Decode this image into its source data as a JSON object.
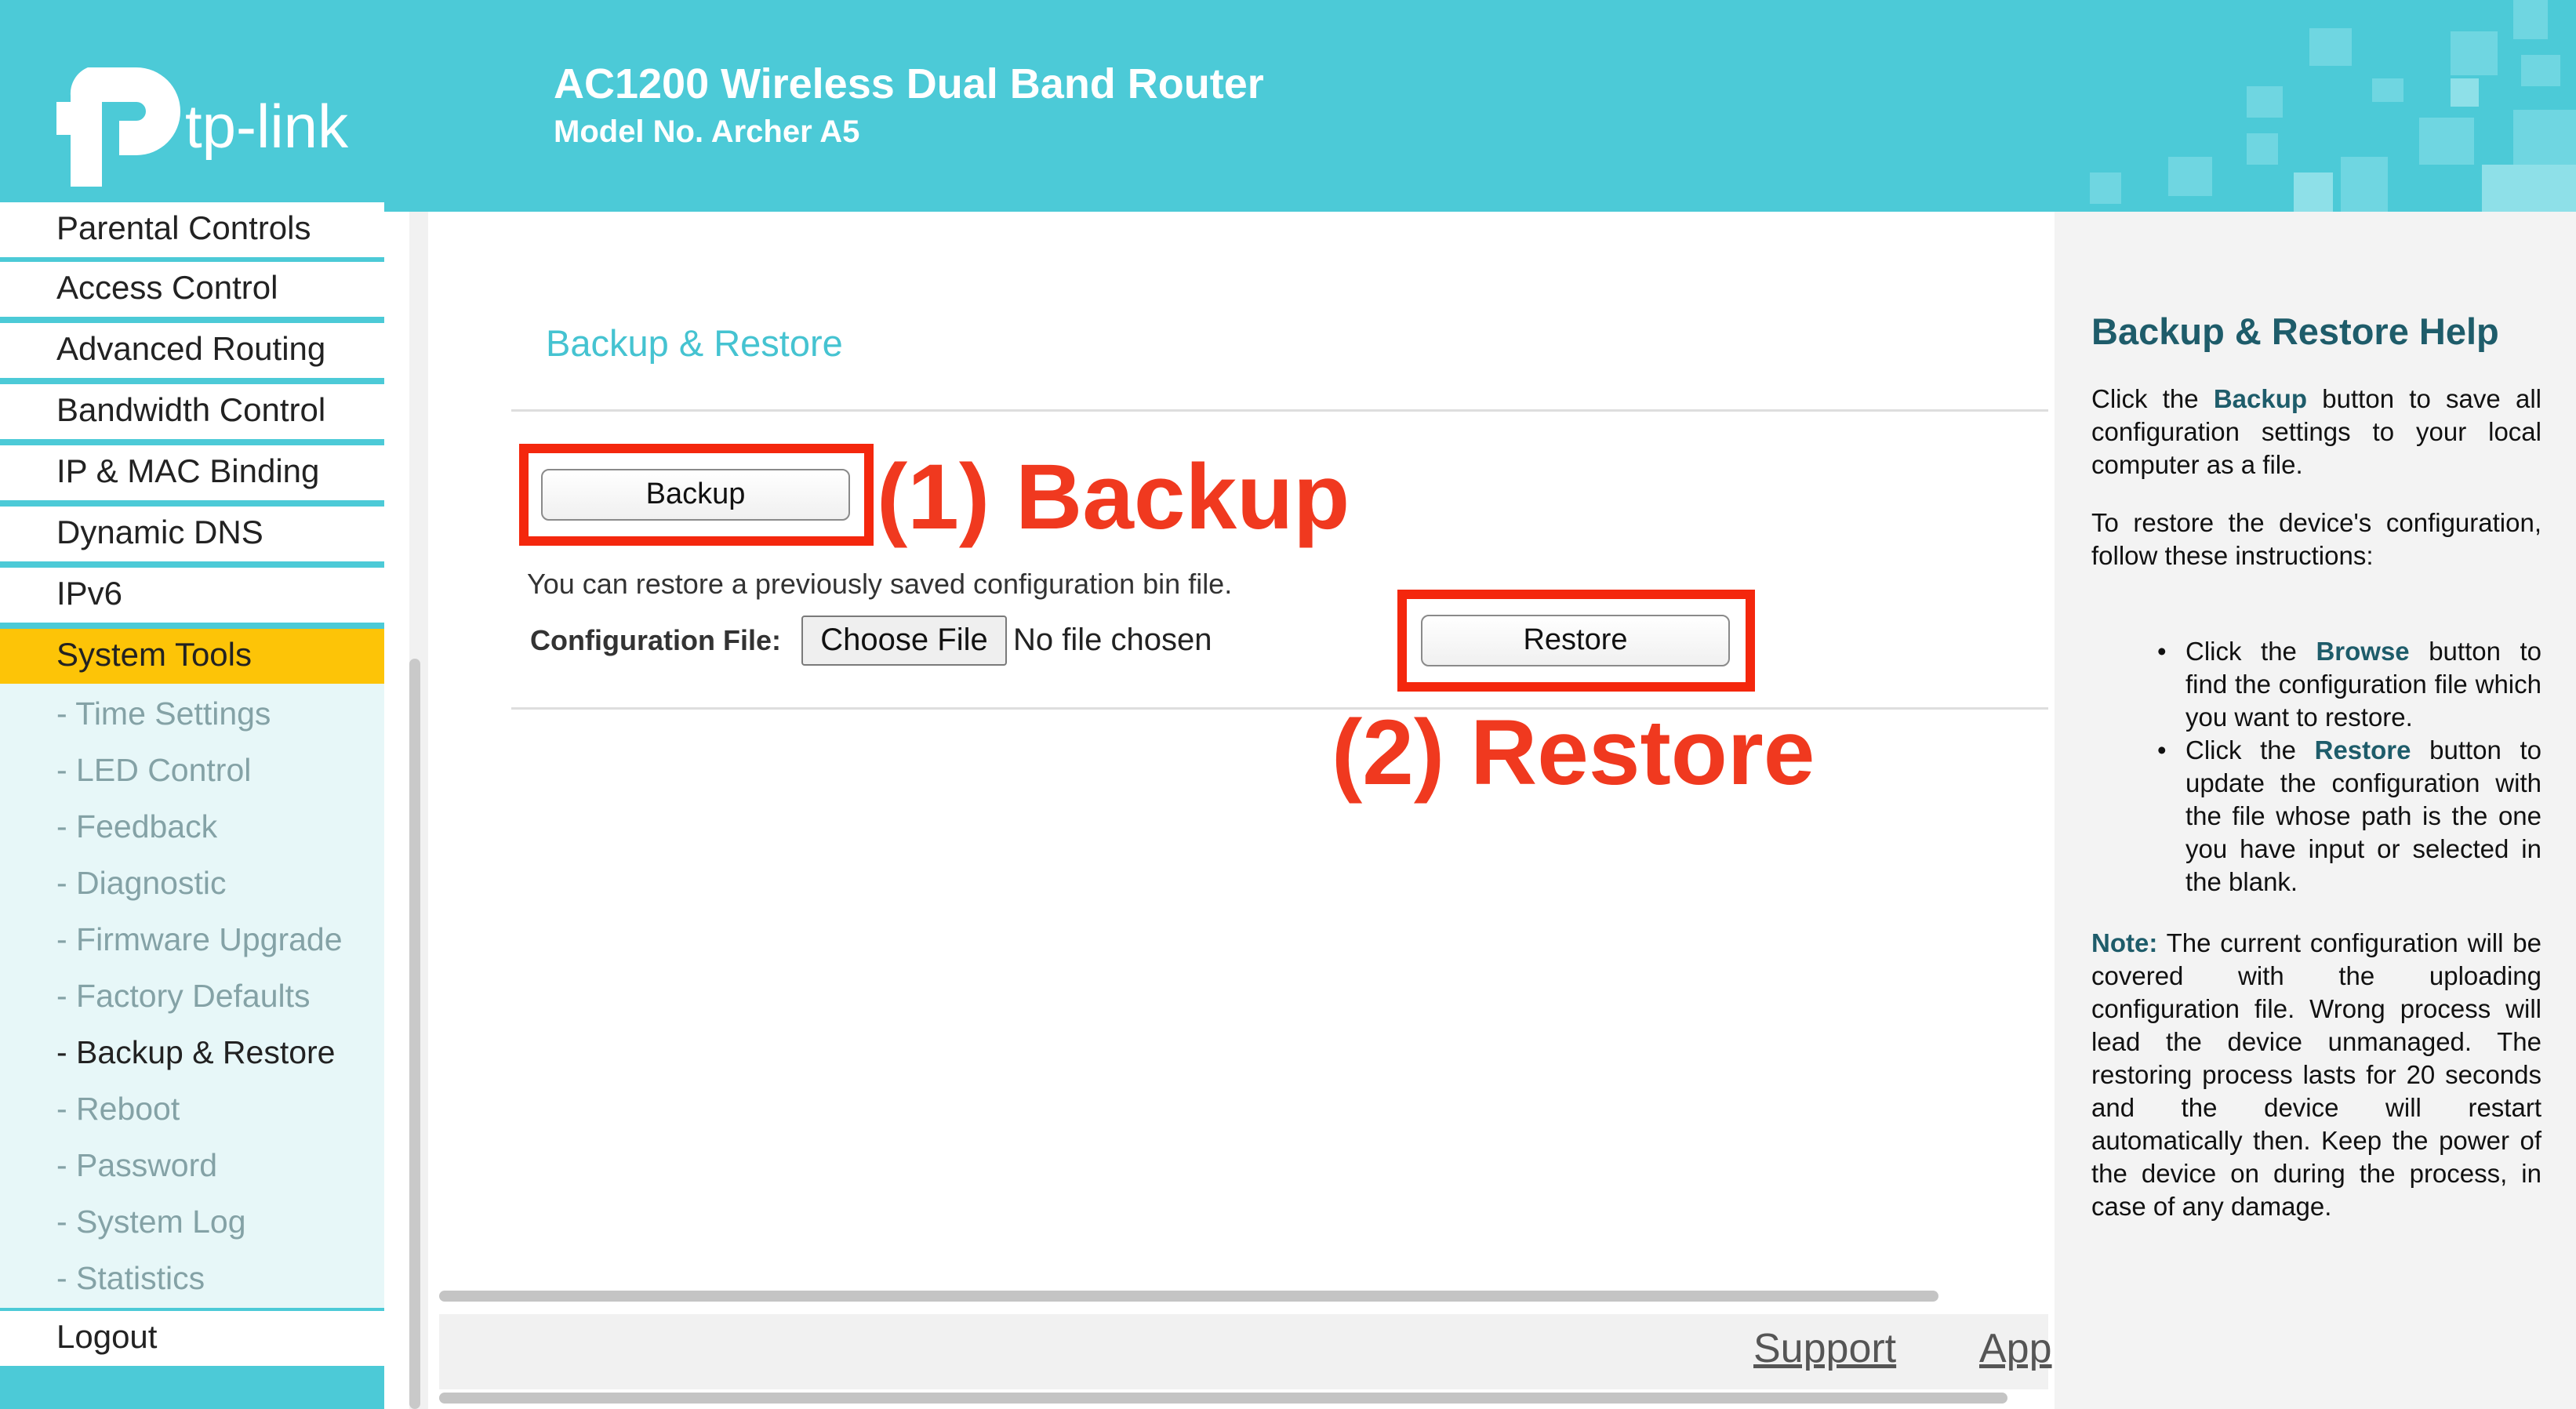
{
  "header": {
    "brand": "tp-link",
    "product_title": "AC1200 Wireless Dual Band Router",
    "model_no": "Model No. Archer A5"
  },
  "sidebar": {
    "items": [
      {
        "label": "Parental Controls"
      },
      {
        "label": "Access Control"
      },
      {
        "label": "Advanced Routing"
      },
      {
        "label": "Bandwidth Control"
      },
      {
        "label": "IP & MAC Binding"
      },
      {
        "label": "Dynamic DNS"
      },
      {
        "label": "IPv6"
      },
      {
        "label": "System Tools"
      }
    ],
    "sub_items": [
      {
        "label": "- Time Settings"
      },
      {
        "label": "- LED Control"
      },
      {
        "label": "- Feedback"
      },
      {
        "label": "- Diagnostic"
      },
      {
        "label": "- Firmware Upgrade"
      },
      {
        "label": "- Factory Defaults"
      },
      {
        "label": "- Backup & Restore"
      },
      {
        "label": "- Reboot"
      },
      {
        "label": "- Password"
      },
      {
        "label": "- System Log"
      },
      {
        "label": "- Statistics"
      }
    ],
    "logout": "Logout"
  },
  "main": {
    "heading": "Backup & Restore",
    "backup_button": "Backup",
    "restore_hint": "You can restore a previously saved configuration bin file.",
    "config_file_label": "Configuration File:",
    "choose_file_button": "Choose File",
    "no_file_text": "No file chosen",
    "restore_button": "Restore"
  },
  "annotations": {
    "backup": "(1) Backup",
    "restore": "(2) Restore",
    "color": "#f4270d"
  },
  "footer": {
    "support": "Support",
    "app": "App"
  },
  "help": {
    "title": "Backup & Restore Help",
    "p1_pre": "Click the ",
    "p1_bold": "Backup",
    "p1_post": " button to save all configuration settings to your local computer as a file.",
    "p2": "To restore the device's configuration, follow these instructions:",
    "li1_pre": "Click the ",
    "li1_bold": "Browse",
    "li1_post": " button to find the configuration file which you want to restore.",
    "li2_pre": "Click the ",
    "li2_bold": "Restore",
    "li2_post": " button to update the configuration with the file whose path is the one you have input or selected in the blank.",
    "note_label": "Note:",
    "note_text": " The current configuration will be covered with the uploading configuration file. Wrong process will lead the device unmanaged. The restoring process lasts for 20 seconds and the device will restart automatically then. Keep the power of the device on during the process, in case of any damage."
  },
  "colors": {
    "brand_teal": "#4ccad7",
    "active_yellow": "#fdc407",
    "heading_teal": "#45c3d1",
    "help_title": "#1e5c6a"
  }
}
